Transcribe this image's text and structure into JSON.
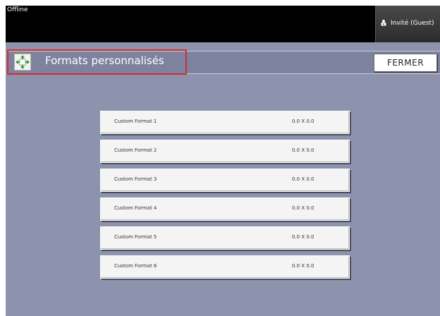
{
  "status": {
    "connection": "Offline"
  },
  "user": {
    "name": "Invité (Guest)",
    "icon": "user-lock-icon"
  },
  "header": {
    "title": "Formats personnalisés",
    "close_label": "FERMER",
    "icon": "custom-format-icon"
  },
  "formats": [
    {
      "name": "Custom Format 1",
      "size": "0.0 X 0.0"
    },
    {
      "name": "Custom Format 2",
      "size": "0.0 X 0.0"
    },
    {
      "name": "Custom Format 3",
      "size": "0.0 X 0.0"
    },
    {
      "name": "Custom Format 4",
      "size": "0.0 X 0.0"
    },
    {
      "name": "Custom Format 5",
      "size": "0.0 X 0.0"
    },
    {
      "name": "Custom Format 6",
      "size": "0.0 X 0.0"
    }
  ],
  "colors": {
    "panel": "#8e93ad",
    "title_bar": "#7d829e",
    "highlight": "#d62c2c",
    "arrow": "#2f9b3a"
  }
}
